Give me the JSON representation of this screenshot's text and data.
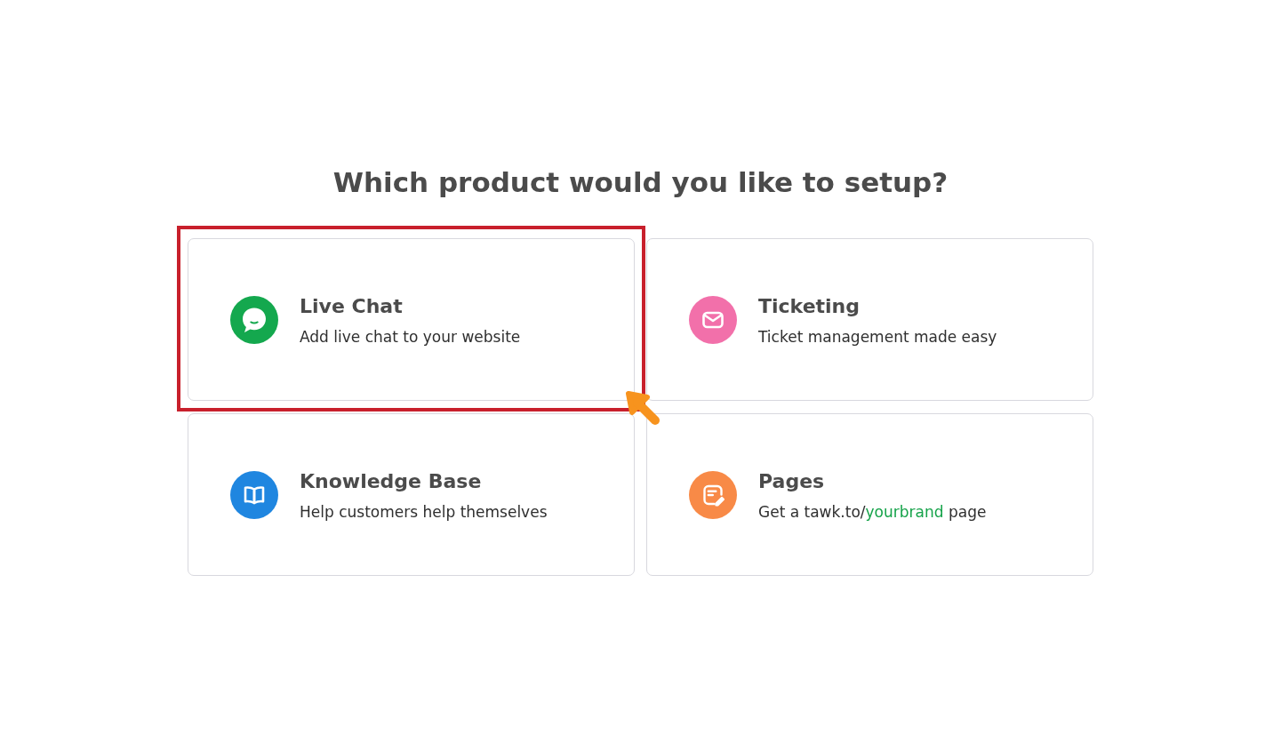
{
  "heading": "Which product would you like to setup?",
  "products": [
    {
      "kind": "chat",
      "title": "Live Chat",
      "color": "#14a84e",
      "highlighted": true,
      "description": [
        {
          "kind": "text",
          "text": "Add live chat to your website"
        }
      ]
    },
    {
      "kind": "ticketing",
      "title": "Ticketing",
      "color": "#f270aa",
      "highlighted": false,
      "description": [
        {
          "kind": "text",
          "text": "Ticket management made easy"
        }
      ]
    },
    {
      "kind": "knowledge",
      "title": "Knowledge Base",
      "color": "#1f86e0",
      "highlighted": false,
      "description": [
        {
          "kind": "text",
          "text": "Help customers help themselves"
        }
      ]
    },
    {
      "kind": "pages",
      "title": "Pages",
      "color": "#f88a47",
      "highlighted": false,
      "description": [
        {
          "kind": "text",
          "text": "Get a tawk.to/"
        },
        {
          "kind": "link",
          "text": "yourbrand"
        },
        {
          "kind": "text",
          "text": " page"
        }
      ]
    }
  ]
}
